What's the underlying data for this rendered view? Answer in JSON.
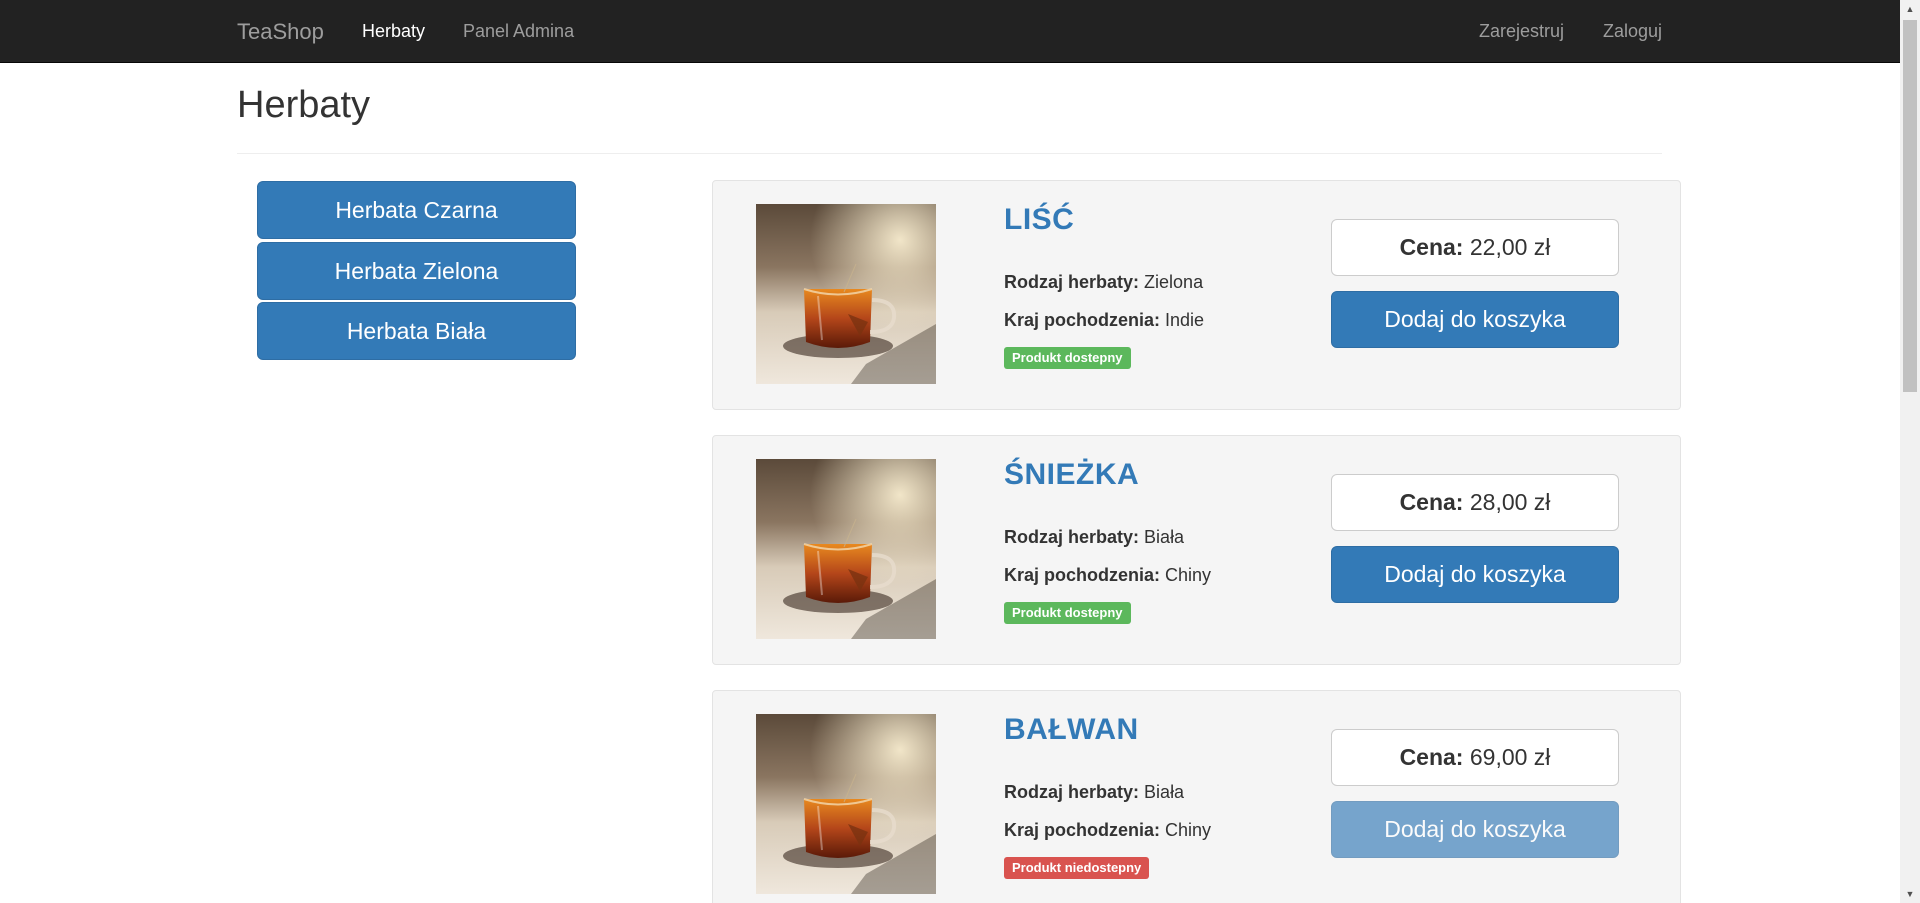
{
  "navbar": {
    "brand": "TeaShop",
    "links": [
      "Herbaty",
      "Panel Admina"
    ],
    "right_links": [
      "Zarejestruj",
      "Zaloguj"
    ]
  },
  "page": {
    "title": "Herbaty"
  },
  "categories": [
    "Herbata Czarna",
    "Herbata Zielona",
    "Herbata Biała"
  ],
  "labels": {
    "type": "Rodzaj herbaty:",
    "origin": "Kraj pochodzenia:",
    "price": "Cena:",
    "add_to_cart": "Dodaj do koszyka"
  },
  "products": [
    {
      "name": "LIŚĆ",
      "type": "Zielona",
      "origin": "Indie",
      "price": "22,00 zł",
      "status": "Produkt dostepny",
      "available": true
    },
    {
      "name": "ŚNIEŻKA",
      "type": "Biała",
      "origin": "Chiny",
      "price": "28,00 zł",
      "status": "Produkt dostepny",
      "available": true
    },
    {
      "name": "BAŁWAN",
      "type": "Biała",
      "origin": "Chiny",
      "price": "69,00 zł",
      "status": "Produkt niedostepny",
      "available": false
    }
  ],
  "colors": {
    "primary": "#337ab7",
    "success": "#5cb85c",
    "danger": "#d9534f",
    "navbar": "#222222"
  }
}
